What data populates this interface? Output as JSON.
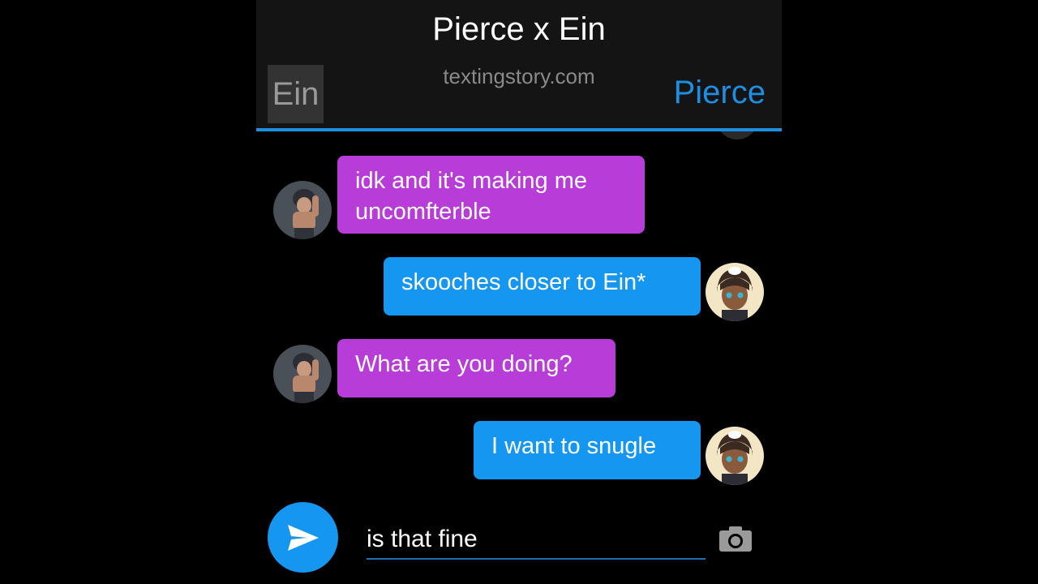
{
  "header": {
    "title": "Pierce x Ein",
    "subtitle": "textingstory.com",
    "left_name": "Ein",
    "right_name": "Pierce"
  },
  "messages": [
    {
      "side": "left",
      "sender": "Ein",
      "text": "idk and it's making me uncomfterble"
    },
    {
      "side": "right",
      "sender": "Pierce",
      "text": "skooches closer to Ein*"
    },
    {
      "side": "left",
      "sender": "Ein",
      "text": "What are you doing?"
    },
    {
      "side": "right",
      "sender": "Pierce",
      "text": "I want to snugle"
    }
  ],
  "composer": {
    "value": "is that fine",
    "send_icon": "send-icon",
    "camera_icon": "camera-icon"
  },
  "colors": {
    "accent": "#1e8fe0",
    "left_bubble": "#b83cd8",
    "right_bubble": "#1596f0",
    "background": "#000000",
    "header": "#141414"
  }
}
